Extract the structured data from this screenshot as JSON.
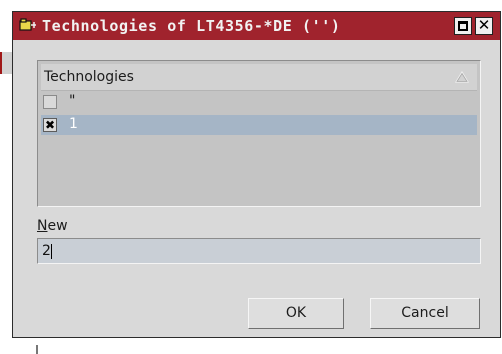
{
  "window": {
    "title": "Technologies of LT4356-*DE ('')",
    "title_bar_color": "#a0232d",
    "title_icon": "folder-pin-icon",
    "maximize_icon": "maximize-icon",
    "close_icon": "close-icon"
  },
  "list": {
    "header": "Technologies",
    "sort_icon": "sort-up-icon",
    "items": [
      {
        "label": "\"",
        "checked": false,
        "selected": false
      },
      {
        "label": "1",
        "checked": true,
        "selected": true
      }
    ],
    "selection_color": "#a5b5c6"
  },
  "new_field": {
    "label_mnemonic": "N",
    "label_rest": "ew",
    "value": "2"
  },
  "buttons": {
    "ok": "OK",
    "cancel": "Cancel"
  }
}
